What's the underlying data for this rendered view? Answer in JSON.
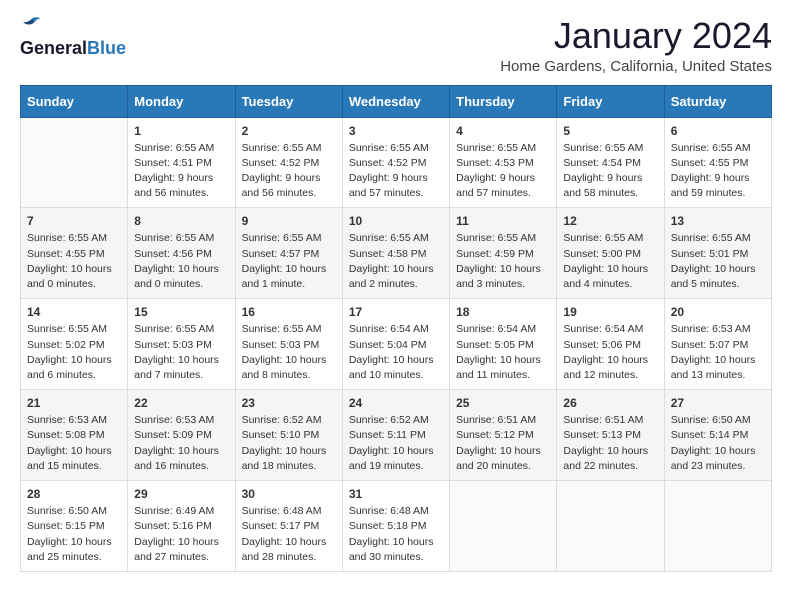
{
  "header": {
    "logo_general": "General",
    "logo_blue": "Blue",
    "title": "January 2024",
    "subtitle": "Home Gardens, California, United States"
  },
  "days_of_week": [
    "Sunday",
    "Monday",
    "Tuesday",
    "Wednesday",
    "Thursday",
    "Friday",
    "Saturday"
  ],
  "weeks": [
    [
      {
        "day": "",
        "info": ""
      },
      {
        "day": "1",
        "info": "Sunrise: 6:55 AM\nSunset: 4:51 PM\nDaylight: 9 hours\nand 56 minutes."
      },
      {
        "day": "2",
        "info": "Sunrise: 6:55 AM\nSunset: 4:52 PM\nDaylight: 9 hours\nand 56 minutes."
      },
      {
        "day": "3",
        "info": "Sunrise: 6:55 AM\nSunset: 4:52 PM\nDaylight: 9 hours\nand 57 minutes."
      },
      {
        "day": "4",
        "info": "Sunrise: 6:55 AM\nSunset: 4:53 PM\nDaylight: 9 hours\nand 57 minutes."
      },
      {
        "day": "5",
        "info": "Sunrise: 6:55 AM\nSunset: 4:54 PM\nDaylight: 9 hours\nand 58 minutes."
      },
      {
        "day": "6",
        "info": "Sunrise: 6:55 AM\nSunset: 4:55 PM\nDaylight: 9 hours\nand 59 minutes."
      }
    ],
    [
      {
        "day": "7",
        "info": "Sunrise: 6:55 AM\nSunset: 4:55 PM\nDaylight: 10 hours\nand 0 minutes."
      },
      {
        "day": "8",
        "info": "Sunrise: 6:55 AM\nSunset: 4:56 PM\nDaylight: 10 hours\nand 0 minutes."
      },
      {
        "day": "9",
        "info": "Sunrise: 6:55 AM\nSunset: 4:57 PM\nDaylight: 10 hours\nand 1 minute."
      },
      {
        "day": "10",
        "info": "Sunrise: 6:55 AM\nSunset: 4:58 PM\nDaylight: 10 hours\nand 2 minutes."
      },
      {
        "day": "11",
        "info": "Sunrise: 6:55 AM\nSunset: 4:59 PM\nDaylight: 10 hours\nand 3 minutes."
      },
      {
        "day": "12",
        "info": "Sunrise: 6:55 AM\nSunset: 5:00 PM\nDaylight: 10 hours\nand 4 minutes."
      },
      {
        "day": "13",
        "info": "Sunrise: 6:55 AM\nSunset: 5:01 PM\nDaylight: 10 hours\nand 5 minutes."
      }
    ],
    [
      {
        "day": "14",
        "info": "Sunrise: 6:55 AM\nSunset: 5:02 PM\nDaylight: 10 hours\nand 6 minutes."
      },
      {
        "day": "15",
        "info": "Sunrise: 6:55 AM\nSunset: 5:03 PM\nDaylight: 10 hours\nand 7 minutes."
      },
      {
        "day": "16",
        "info": "Sunrise: 6:55 AM\nSunset: 5:03 PM\nDaylight: 10 hours\nand 8 minutes."
      },
      {
        "day": "17",
        "info": "Sunrise: 6:54 AM\nSunset: 5:04 PM\nDaylight: 10 hours\nand 10 minutes."
      },
      {
        "day": "18",
        "info": "Sunrise: 6:54 AM\nSunset: 5:05 PM\nDaylight: 10 hours\nand 11 minutes."
      },
      {
        "day": "19",
        "info": "Sunrise: 6:54 AM\nSunset: 5:06 PM\nDaylight: 10 hours\nand 12 minutes."
      },
      {
        "day": "20",
        "info": "Sunrise: 6:53 AM\nSunset: 5:07 PM\nDaylight: 10 hours\nand 13 minutes."
      }
    ],
    [
      {
        "day": "21",
        "info": "Sunrise: 6:53 AM\nSunset: 5:08 PM\nDaylight: 10 hours\nand 15 minutes."
      },
      {
        "day": "22",
        "info": "Sunrise: 6:53 AM\nSunset: 5:09 PM\nDaylight: 10 hours\nand 16 minutes."
      },
      {
        "day": "23",
        "info": "Sunrise: 6:52 AM\nSunset: 5:10 PM\nDaylight: 10 hours\nand 18 minutes."
      },
      {
        "day": "24",
        "info": "Sunrise: 6:52 AM\nSunset: 5:11 PM\nDaylight: 10 hours\nand 19 minutes."
      },
      {
        "day": "25",
        "info": "Sunrise: 6:51 AM\nSunset: 5:12 PM\nDaylight: 10 hours\nand 20 minutes."
      },
      {
        "day": "26",
        "info": "Sunrise: 6:51 AM\nSunset: 5:13 PM\nDaylight: 10 hours\nand 22 minutes."
      },
      {
        "day": "27",
        "info": "Sunrise: 6:50 AM\nSunset: 5:14 PM\nDaylight: 10 hours\nand 23 minutes."
      }
    ],
    [
      {
        "day": "28",
        "info": "Sunrise: 6:50 AM\nSunset: 5:15 PM\nDaylight: 10 hours\nand 25 minutes."
      },
      {
        "day": "29",
        "info": "Sunrise: 6:49 AM\nSunset: 5:16 PM\nDaylight: 10 hours\nand 27 minutes."
      },
      {
        "day": "30",
        "info": "Sunrise: 6:48 AM\nSunset: 5:17 PM\nDaylight: 10 hours\nand 28 minutes."
      },
      {
        "day": "31",
        "info": "Sunrise: 6:48 AM\nSunset: 5:18 PM\nDaylight: 10 hours\nand 30 minutes."
      },
      {
        "day": "",
        "info": ""
      },
      {
        "day": "",
        "info": ""
      },
      {
        "day": "",
        "info": ""
      }
    ]
  ]
}
